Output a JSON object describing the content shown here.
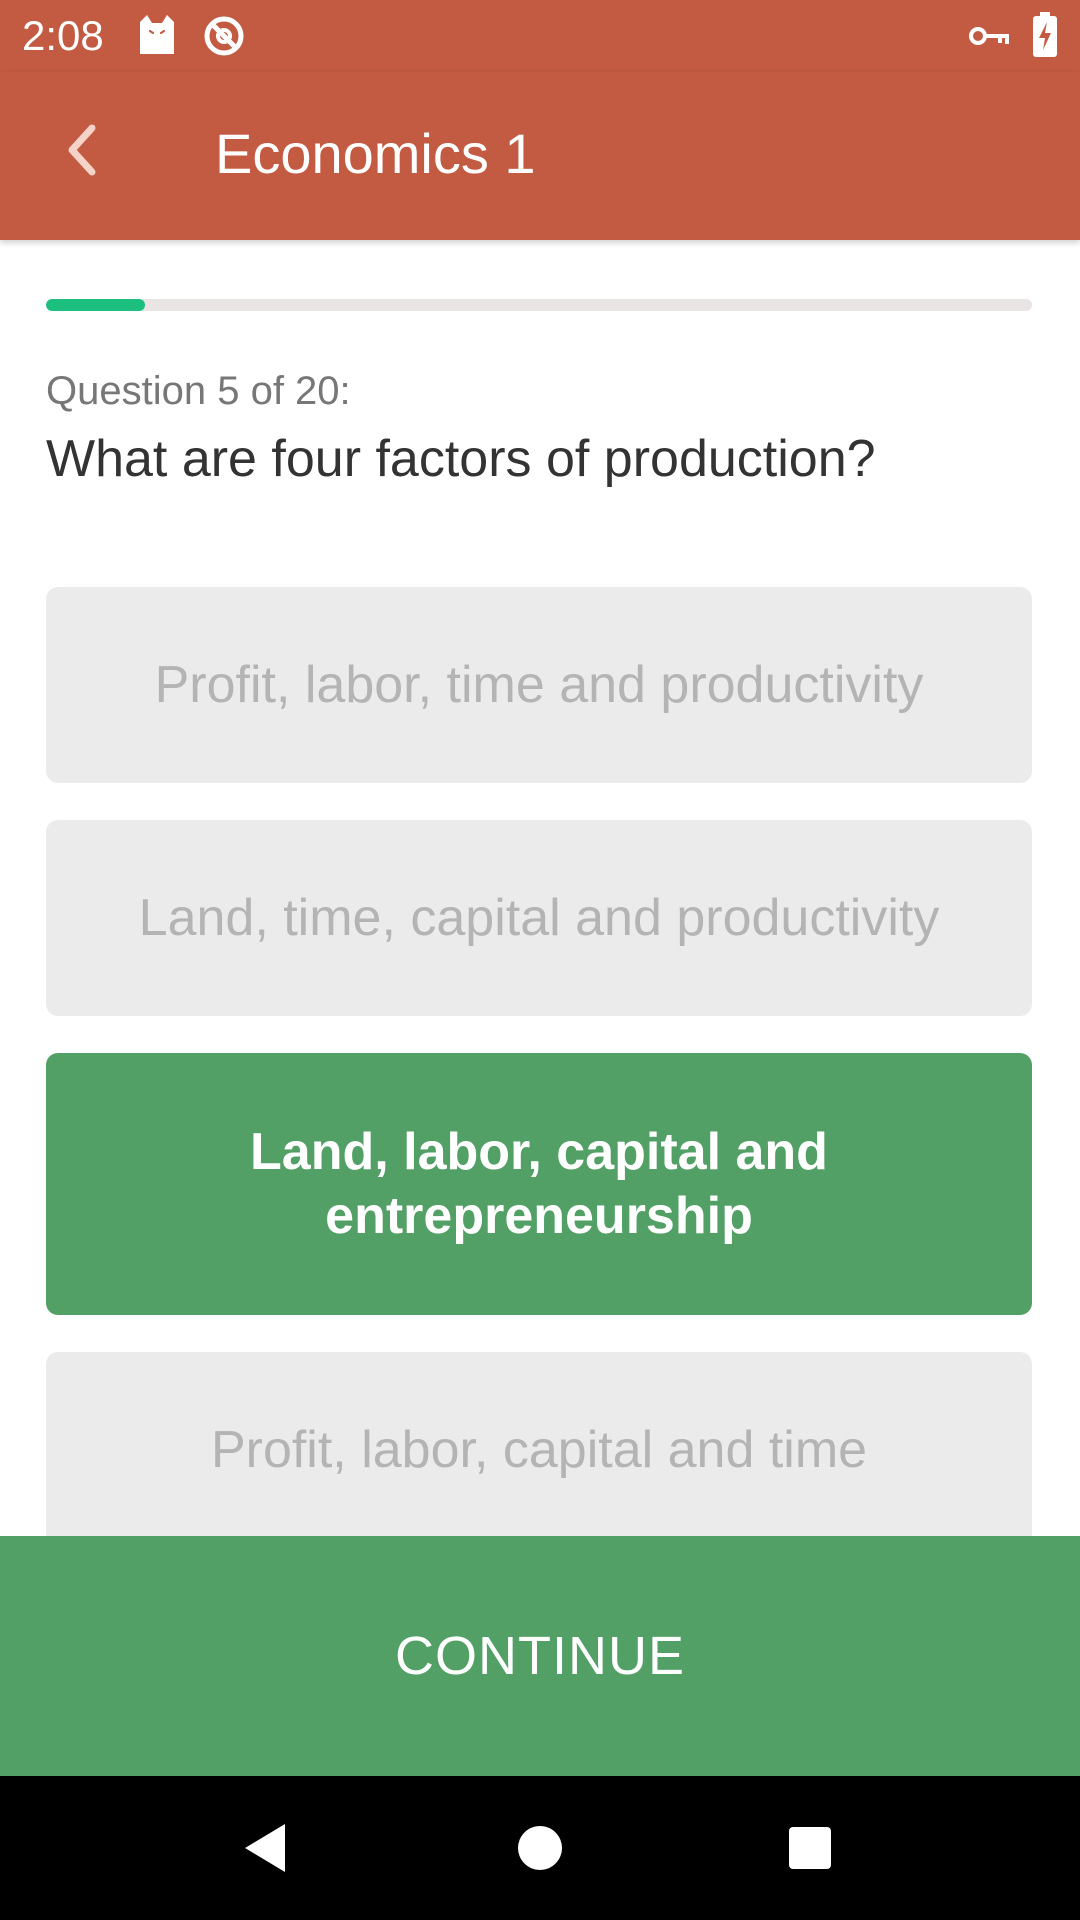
{
  "status_bar": {
    "time": "2:08",
    "icons": [
      "cat-icon",
      "no-sync-icon",
      "key-icon",
      "battery-charging-icon"
    ]
  },
  "app_bar": {
    "title": "Economics 1",
    "back_icon": "chevron-left-icon"
  },
  "progress": {
    "fraction": 0.1
  },
  "question": {
    "counter": "Question 5 of 20:",
    "text": "What are four factors of production?"
  },
  "answers": [
    {
      "label": "Profit, labor, time and productivity",
      "selected": false
    },
    {
      "label": "Land, time, capital and productivity",
      "selected": false
    },
    {
      "label": "Land, labor, capital and entrepreneurship",
      "selected": true
    },
    {
      "label": "Profit, labor, capital and time",
      "selected": false
    }
  ],
  "continue_label": "CONTINUE",
  "colors": {
    "header": "#c25b42",
    "selected_answer": "#52a066",
    "continue_button": "#52a066",
    "progress_fill": "#1dbf7e",
    "answer_background": "#ebebeb"
  },
  "nav_bar": {
    "icons": [
      "back-triangle-icon",
      "home-circle-icon",
      "recents-square-icon"
    ]
  }
}
